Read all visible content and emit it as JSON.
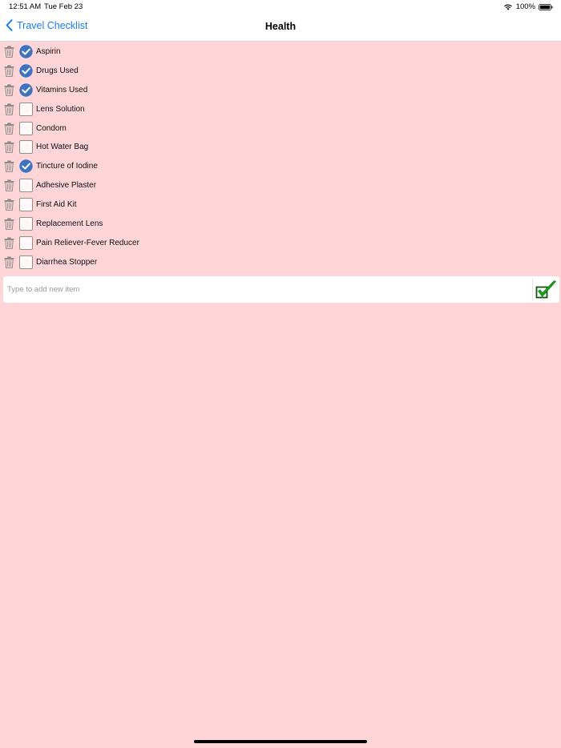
{
  "status_bar": {
    "time": "12:51 AM",
    "date": "Tue Feb 23",
    "battery": "100%"
  },
  "nav": {
    "back_label": "Travel Checklist",
    "title": "Health"
  },
  "items": [
    {
      "label": "Aspirin",
      "checked": true
    },
    {
      "label": "Drugs Used",
      "checked": true
    },
    {
      "label": "Vitamins Used",
      "checked": true
    },
    {
      "label": "Lens Solution",
      "checked": false
    },
    {
      "label": "Condom",
      "checked": false
    },
    {
      "label": "Hot Water Bag",
      "checked": false
    },
    {
      "label": "Tincture of Iodine",
      "checked": true
    },
    {
      "label": "Adhesive Plaster",
      "checked": false
    },
    {
      "label": "First Aid Kit",
      "checked": false
    },
    {
      "label": "Replacement Lens",
      "checked": false
    },
    {
      "label": "Pain Reliever-Fever Reducer",
      "checked": false
    },
    {
      "label": "Diarrhea Stopper",
      "checked": false
    }
  ],
  "add_item": {
    "placeholder": "Type to add new item",
    "value": ""
  },
  "colors": {
    "background": "#ffd5d8",
    "accent": "#1a7cf0",
    "check_fill": "#3d73c0",
    "confirm_green": "#1aa51a"
  },
  "icons": {
    "back": "chevron-left-icon",
    "delete": "trash-icon",
    "checked": "checkmark-circle-icon",
    "confirm": "green-checkmark-box-icon",
    "wifi": "wifi-icon",
    "battery": "battery-full-icon"
  }
}
